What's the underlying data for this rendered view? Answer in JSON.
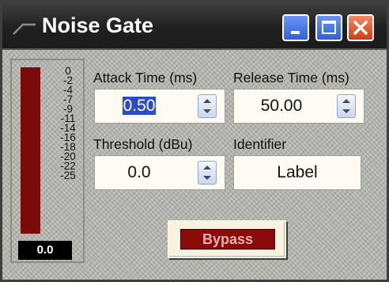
{
  "window": {
    "title": "Noise Gate",
    "icon": "gate-curve-icon",
    "controls": [
      "minimize-icon",
      "maximize-icon",
      "close-icon"
    ]
  },
  "meter": {
    "scale": [
      "0",
      "-2",
      "-4",
      "-7",
      "-9",
      "-11",
      "-14",
      "-16",
      "-18",
      "-20",
      "-22",
      "-25"
    ],
    "readout": "0.0",
    "bar_color": "#7b0a0a"
  },
  "controls": {
    "attack": {
      "label": "Attack Time (ms)",
      "value": "0.50"
    },
    "release": {
      "label": "Release Time (ms)",
      "value": "50.00"
    },
    "threshold": {
      "label": "Threshold (dBu)",
      "value": "0.0"
    },
    "identifier": {
      "label": "Identifier",
      "value": "Label"
    }
  },
  "bypass": {
    "label": "Bypass",
    "color": "#8b0b0b"
  }
}
